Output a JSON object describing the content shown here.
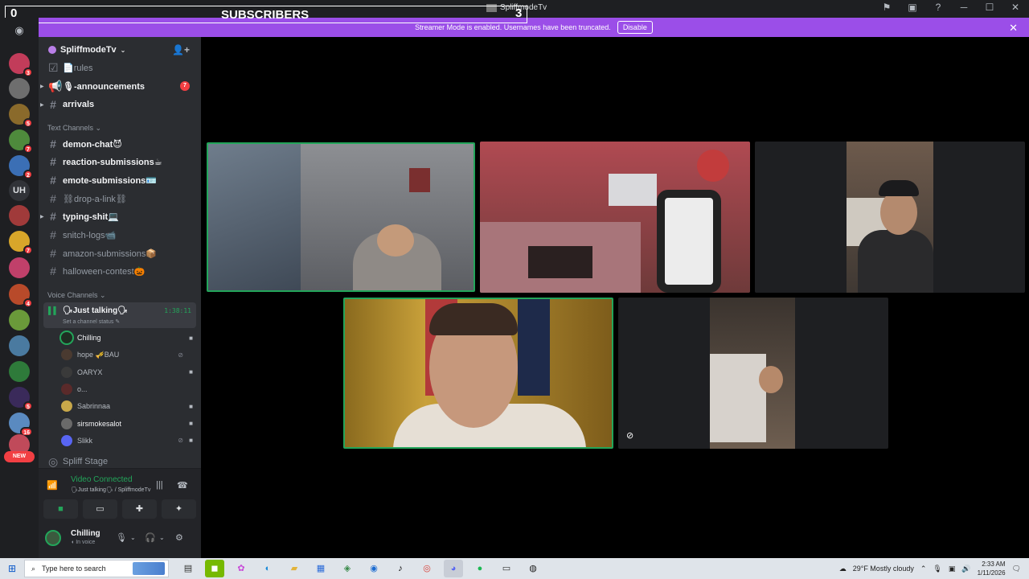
{
  "overlay": {
    "left_count": "0",
    "label": "SUBSCRIBERS",
    "right_count": "3"
  },
  "titlebar": {
    "title": "SpliffmodeTv"
  },
  "banner": {
    "message": "Streamer Mode is enabled. Usernames have been truncated.",
    "disable_label": "Disable"
  },
  "rail": {
    "servers": [
      {
        "badge": "3",
        "color": "#c23c5a"
      },
      {
        "badge": "",
        "color": "#6e6e6e"
      },
      {
        "badge": "5",
        "color": "#8a6a2b"
      },
      {
        "badge": "7",
        "color": "#4e8a3c"
      },
      {
        "badge": "2",
        "color": "#3b6fb5"
      },
      {
        "text": "UH"
      },
      {
        "badge": "",
        "color": "#a03a3a"
      },
      {
        "badge": "7",
        "color": "#d8a62a"
      },
      {
        "badge": "",
        "color": "#c0406a"
      },
      {
        "badge": "4",
        "color": "#b84a2a"
      },
      {
        "badge": "",
        "color": "#6a9a3a"
      },
      {
        "badge": "",
        "color": "#4a7aa0"
      },
      {
        "badge": "",
        "color": "#2e7a3a"
      },
      {
        "badge": "5",
        "color": "#3a2a5a"
      },
      {
        "badge": "16",
        "color": "#5a8ac0"
      },
      {
        "badge": "",
        "color": "#c04a5a"
      }
    ],
    "new_label": "NEW"
  },
  "guild": {
    "name": "SpliffmodeTv"
  },
  "channels_top": [
    {
      "name": "📄rules",
      "bright": false
    },
    {
      "name": "🎙-announcements",
      "bright": true,
      "ping": "7"
    },
    {
      "name": "arrivals",
      "bright": true
    }
  ],
  "text_category": "Text Channels",
  "text_channels": [
    {
      "name": "demon-chat😈",
      "bright": true
    },
    {
      "name": "reaction-submissions☕",
      "bright": true
    },
    {
      "name": "emote-submissions🪪",
      "bright": true
    },
    {
      "name": "⛓drop-a-link⛓",
      "bright": false
    },
    {
      "name": "typing-shit💻",
      "bright": true
    },
    {
      "name": "snitch-logs📹",
      "bright": false
    },
    {
      "name": "amazon-submissions📦",
      "bright": false
    },
    {
      "name": "halloween-contest🎃",
      "bright": false
    }
  ],
  "voice_category": "Voice Channels",
  "voice_channel": {
    "name": "🗣Just talking🗣",
    "time": "1:38:11",
    "status": "Set a channel status"
  },
  "members": [
    {
      "name": "Chilling",
      "bold": true,
      "ring": true,
      "cam": true,
      "mic": false
    },
    {
      "name": "hope 🎺BAU",
      "bold": false,
      "ring": false,
      "cam": false,
      "mic": true
    },
    {
      "name": "OARYX",
      "bold": false,
      "ring": false,
      "cam": true,
      "mic": false
    },
    {
      "name": "o...",
      "bold": false,
      "ring": false,
      "cam": false,
      "mic": false
    },
    {
      "name": "Sabrinnaa",
      "bold": false,
      "ring": false,
      "cam": true,
      "mic": false
    },
    {
      "name": "sirsmokesalot",
      "bold": true,
      "ring": false,
      "cam": true,
      "mic": false
    },
    {
      "name": "Slikk",
      "bold": false,
      "ring": false,
      "cam": true,
      "mic": true
    }
  ],
  "stage_channel": "Spliff Stage",
  "rtc": {
    "status": "Video Connected",
    "sub": "🗣Just talking🗣 / SpliffmodeTv"
  },
  "user": {
    "name": "Chilling",
    "status": "In voice"
  },
  "taskbar": {
    "search_placeholder": "Type here to search",
    "weather": "29°F  Mostly cloudy",
    "time": "2:33 AM",
    "date": "1/11/2026"
  }
}
